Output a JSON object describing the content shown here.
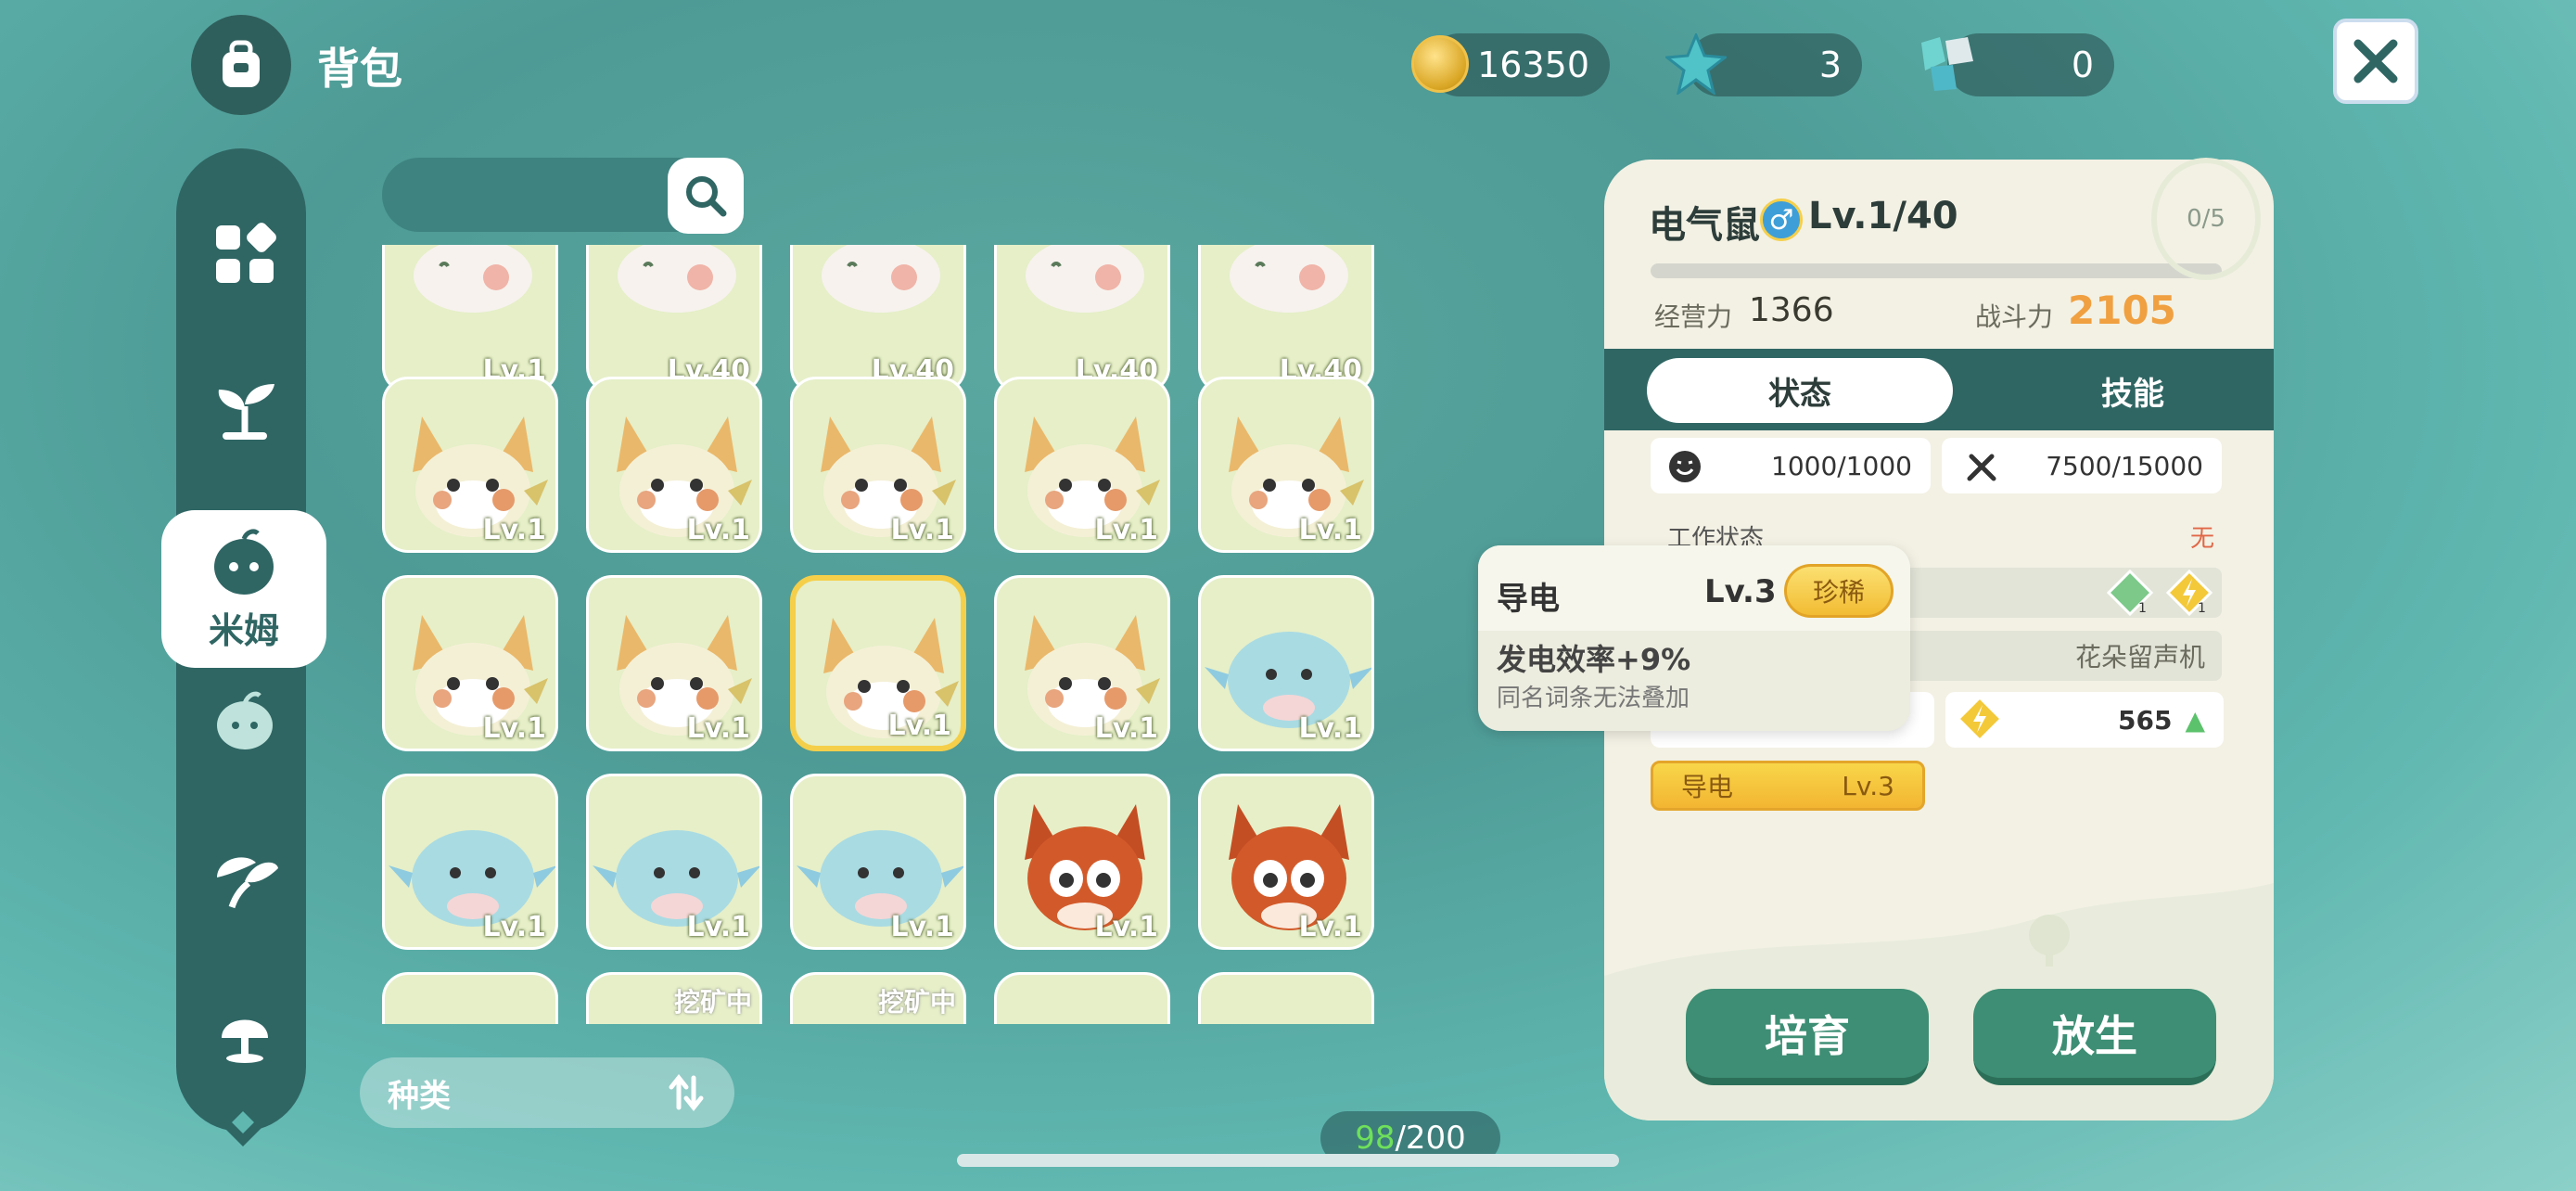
{
  "header": {
    "title": "背包",
    "coins": "16350",
    "stars": "3",
    "gems": "0"
  },
  "search": {
    "placeholder": ""
  },
  "sidebar": {
    "active_label": "米姆"
  },
  "grid": {
    "rows": [
      {
        "kind": "white",
        "levels": [
          "Lv.1",
          "Lv.40",
          "Lv.40",
          "Lv.40",
          "Lv.40"
        ]
      },
      {
        "kind": "yellow",
        "levels": [
          "Lv.1",
          "Lv.1",
          "Lv.1",
          "Lv.1",
          "Lv.1"
        ]
      },
      {
        "kind": "mixed",
        "levels": [
          "Lv.1",
          "Lv.1",
          "Lv.1",
          "Lv.1",
          "Lv.1"
        ]
      },
      {
        "kind": "mixed2",
        "levels": [
          "Lv.1",
          "Lv.1",
          "Lv.1",
          "Lv.1",
          "Lv.1"
        ]
      }
    ],
    "partial_mine_label": "挖矿中"
  },
  "filter": {
    "label": "种类"
  },
  "count": {
    "current": "98",
    "total": "/200"
  },
  "detail": {
    "name": "电气鼠",
    "gender": "♂",
    "level": "Lv.1/40",
    "fruit": "0/5",
    "manage_label": "经营力",
    "manage_value": "1366",
    "power_label": "战斗力",
    "power_value": "2105",
    "tab_status": "状态",
    "tab_skill": "技能",
    "mood": "1000/1000",
    "food": "7500/15000",
    "work_label": "工作状态",
    "work_value": "无",
    "location": "花朵留声机",
    "elec_value": "565",
    "trait_name": "导电",
    "trait_level": "Lv.3",
    "btn_train": "培育",
    "btn_release": "放生"
  },
  "tooltip": {
    "name": "导电",
    "level": "Lv.3",
    "rarity": "珍稀",
    "effect": "发电效率+9%",
    "note": "同名词条无法叠加"
  },
  "colors": {
    "accent_green": "#3d8e74",
    "panel_dark": "#2f6664",
    "gold": "#f5cf4a",
    "power_orange": "#f0a040"
  }
}
